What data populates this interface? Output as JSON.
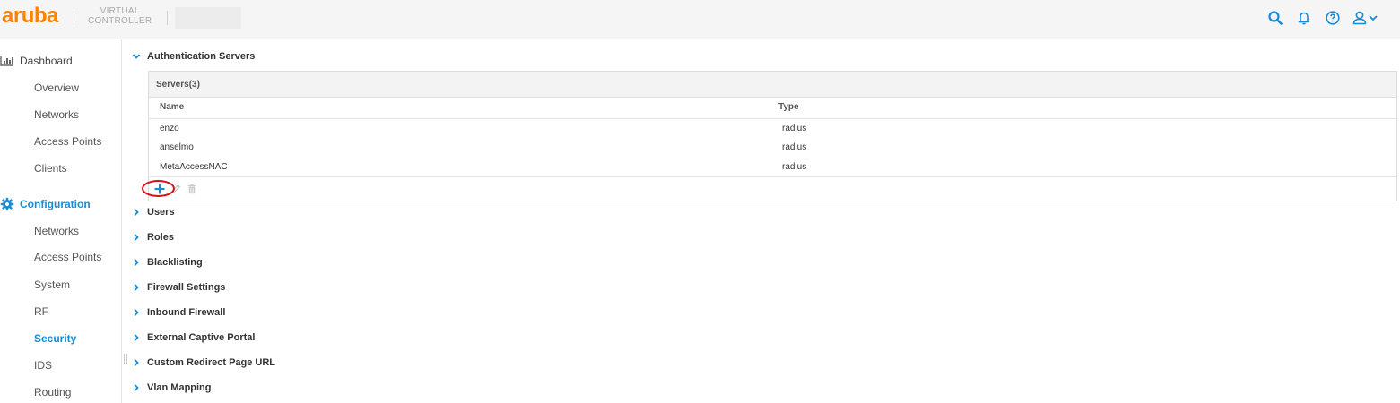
{
  "header": {
    "logo": "aruba",
    "product_line1": "VIRTUAL",
    "product_line2": "CONTROLLER",
    "icons": [
      "search-icon",
      "bell-icon",
      "help-icon",
      "user-icon",
      "chevron-down-icon"
    ],
    "accent_color": "#1a8bd3",
    "brand_color": "#ff8300"
  },
  "sidebar": {
    "dashboard": {
      "label": "Dashboard",
      "items": [
        "Overview",
        "Networks",
        "Access Points",
        "Clients"
      ]
    },
    "configuration": {
      "label": "Configuration",
      "items": [
        "Networks",
        "Access Points",
        "System",
        "RF",
        "Security",
        "IDS",
        "Routing"
      ],
      "active": "Security"
    }
  },
  "main": {
    "auth_servers": {
      "title": "Authentication Servers",
      "panel_title": "Servers(3)",
      "columns": [
        "Name",
        "Type"
      ],
      "rows": [
        {
          "name": "enzo",
          "type": "radius"
        },
        {
          "name": "anselmo",
          "type": "radius"
        },
        {
          "name": "MetaAccessNAC",
          "type": "radius"
        }
      ]
    },
    "sections": [
      "Users",
      "Roles",
      "Blacklisting",
      "Firewall Settings",
      "Inbound Firewall",
      "External Captive Portal",
      "Custom Redirect Page URL",
      "Vlan Mapping"
    ]
  }
}
